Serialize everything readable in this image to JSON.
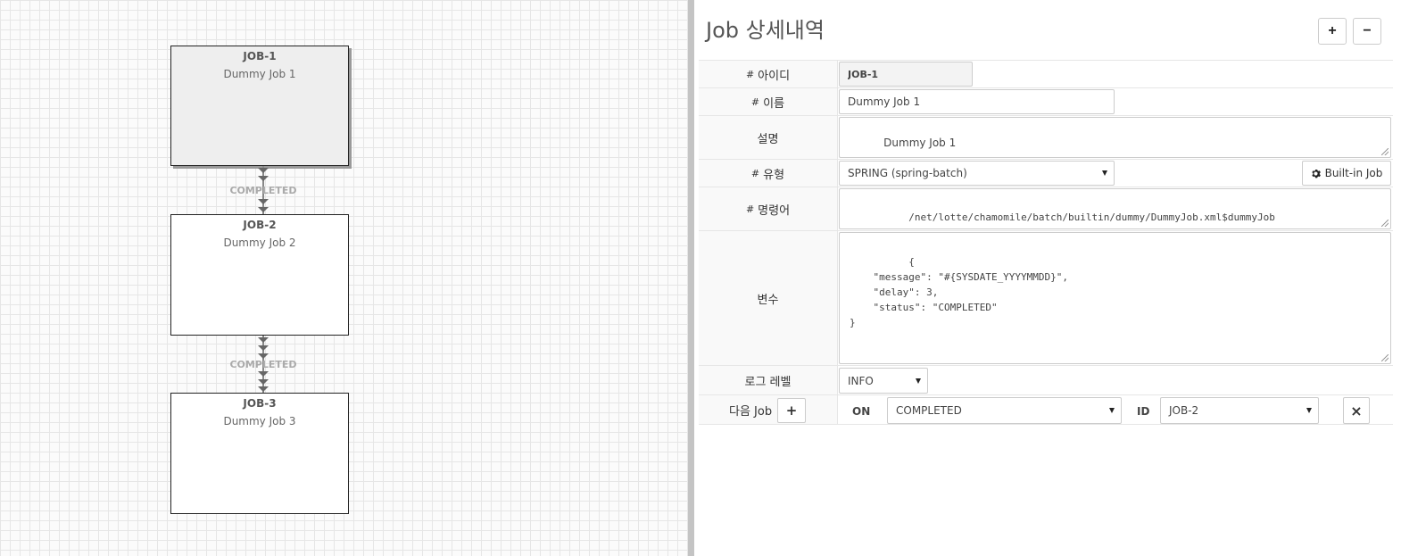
{
  "canvas": {
    "jobs": [
      {
        "id": "JOB-1",
        "name": "Dummy Job 1"
      },
      {
        "id": "JOB-2",
        "name": "Dummy Job 2"
      },
      {
        "id": "JOB-3",
        "name": "Dummy Job 3"
      }
    ],
    "connectors": [
      {
        "label": "COMPLETED"
      },
      {
        "label": "COMPLETED"
      }
    ]
  },
  "panel": {
    "title": "Job 상세내역",
    "expand_label": "+",
    "collapse_label": "−",
    "fields": {
      "id": {
        "hash": "#",
        "label": "아이디",
        "value": "JOB-1"
      },
      "name": {
        "hash": "#",
        "label": "이름",
        "value": "Dummy Job 1"
      },
      "description": {
        "label": "설명",
        "value": "Dummy Job 1"
      },
      "type": {
        "hash": "#",
        "label": "유형",
        "value": "SPRING (spring-batch)",
        "builtin_label": "Built-in Job"
      },
      "command": {
        "hash": "#",
        "label": "명령어",
        "value": "/net/lotte/chamomile/batch/builtin/dummy/DummyJob.xml$dummyJob"
      },
      "variables": {
        "label": "변수",
        "value": "{\n    \"message\": \"#{SYSDATE_YYYYMMDD}\",\n    \"delay\": 3,\n    \"status\": \"COMPLETED\"\n}"
      },
      "log_level": {
        "label": "로그 레벨",
        "value": "INFO"
      },
      "next_job": {
        "label": "다음 Job",
        "add_label": "+",
        "on_label": "ON",
        "on_value": "COMPLETED",
        "id_label": "ID",
        "id_value": "JOB-2",
        "remove_label": "×"
      }
    }
  }
}
